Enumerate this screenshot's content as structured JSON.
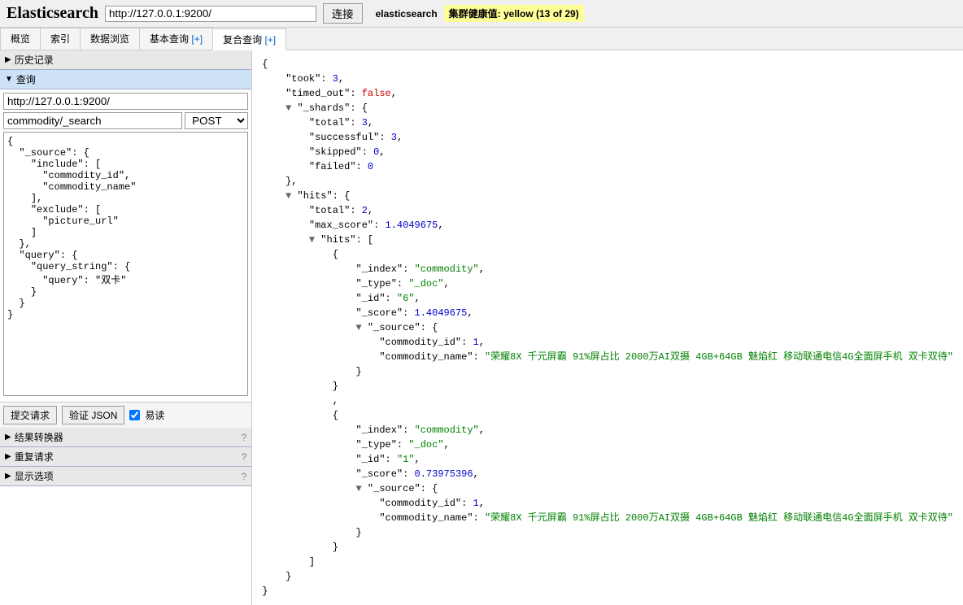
{
  "header": {
    "logo": "Elasticsearch",
    "url": "http://127.0.0.1:9200/",
    "connect": "连接",
    "app_name": "elasticsearch",
    "health": "集群健康值: yellow (13 of 29)"
  },
  "tabs": {
    "overview": "概览",
    "indices": "索引",
    "browse": "数据浏览",
    "basic_query": "基本查询",
    "compound_query": "复合查询",
    "plus": "[+]"
  },
  "sidebar": {
    "history": "历史记录",
    "query": "查询",
    "url_value": "http://127.0.0.1:9200/",
    "path_value": "commodity/_search",
    "method": "POST",
    "body": "{\n  \"_source\": {\n    \"include\": [\n      \"commodity_id\",\n      \"commodity_name\"\n    ],\n    \"exclude\": [\n      \"picture_url\"\n    ]\n  },\n  \"query\": {\n    \"query_string\": {\n      \"query\": \"双卡\"\n    }\n  }\n}",
    "submit": "提交请求",
    "validate": "验证 JSON",
    "readable": "易读",
    "result_transform": "结果转换器",
    "repeat": "重复请求",
    "display_opts": "显示选项"
  },
  "response": {
    "took": 3,
    "timed_out": "false",
    "shards_total": 3,
    "shards_successful": 3,
    "shards_skipped": 0,
    "shards_failed": 0,
    "hits_total": 2,
    "max_score": 1.4049675,
    "hit1_index": "commodity",
    "hit1_type": "_doc",
    "hit1_id": "6",
    "hit1_score": 1.4049675,
    "hit1_commodity_id": 1,
    "hit1_commodity_name": "荣耀8X 千元屏霸 91%屏占比 2000万AI双摄 4GB+64GB 魅焰红 移动联通电信4G全面屏手机 双卡双待",
    "hit2_index": "commodity",
    "hit2_type": "_doc",
    "hit2_id": "1",
    "hit2_score": 0.73975396,
    "hit2_commodity_id": 1,
    "hit2_commodity_name": "荣耀8X 千元屏霸 91%屏占比 2000万AI双摄 4GB+64GB 魅焰红 移动联通电信4G全面屏手机 双卡双待"
  }
}
